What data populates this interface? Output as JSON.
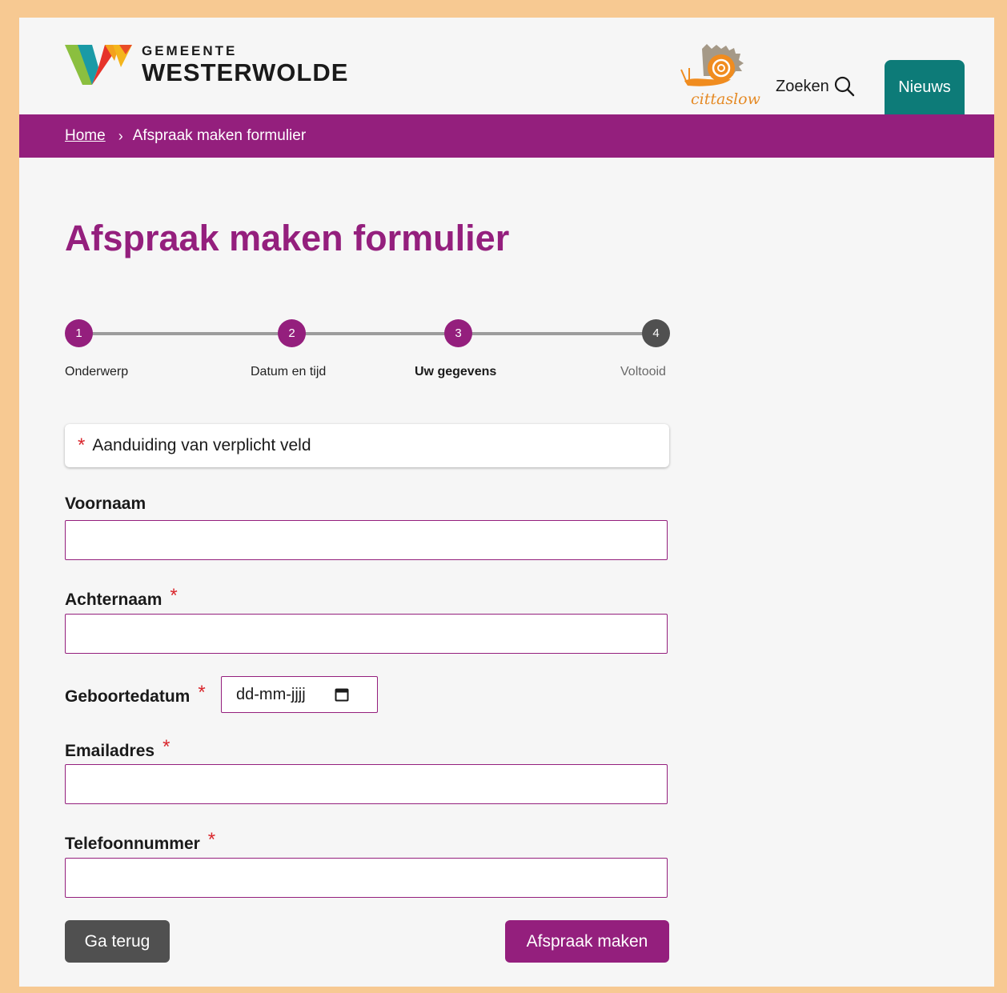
{
  "header": {
    "logo_line1": "GEMEENTE",
    "logo_line2": "WESTERWOLDE",
    "partner_logo_text": "cittaslow",
    "search_label": "Zoeken",
    "news_tab_label": "Nieuws"
  },
  "breadcrumb": {
    "home": "Home",
    "separator": "›",
    "current": "Afspraak maken formulier"
  },
  "page": {
    "title": "Afspraak maken formulier"
  },
  "stepper": {
    "steps": [
      {
        "number": "1",
        "label": "Onderwerp",
        "state": "completed"
      },
      {
        "number": "2",
        "label": "Datum en tijd",
        "state": "completed"
      },
      {
        "number": "3",
        "label": "Uw gegevens",
        "state": "current"
      },
      {
        "number": "4",
        "label": "Voltooid",
        "state": "upcoming"
      }
    ]
  },
  "form": {
    "required_notice": "Aanduiding van verplicht veld",
    "required_marker": "*",
    "fields": {
      "first_name": {
        "label": "Voornaam",
        "value": "",
        "required": false
      },
      "last_name": {
        "label": "Achternaam",
        "value": "",
        "required": true
      },
      "birth_date": {
        "label": "Geboortedatum",
        "placeholder": "dd-mm-jjjj",
        "required": true
      },
      "email": {
        "label": "Emailadres",
        "value": "",
        "required": true
      },
      "phone": {
        "label": "Telefoonnummer",
        "value": "",
        "required": true
      }
    },
    "back_button": "Ga terug",
    "submit_button": "Afspraak maken"
  },
  "colors": {
    "brand_purple": "#941f7d",
    "news_teal": "#0d7b78",
    "required_red": "#d9262c",
    "back_gray": "#505050",
    "page_border": "#f7c992"
  },
  "icons": {
    "search": "search-icon",
    "calendar": "calendar-icon",
    "chevron": "chevron-right-icon"
  }
}
